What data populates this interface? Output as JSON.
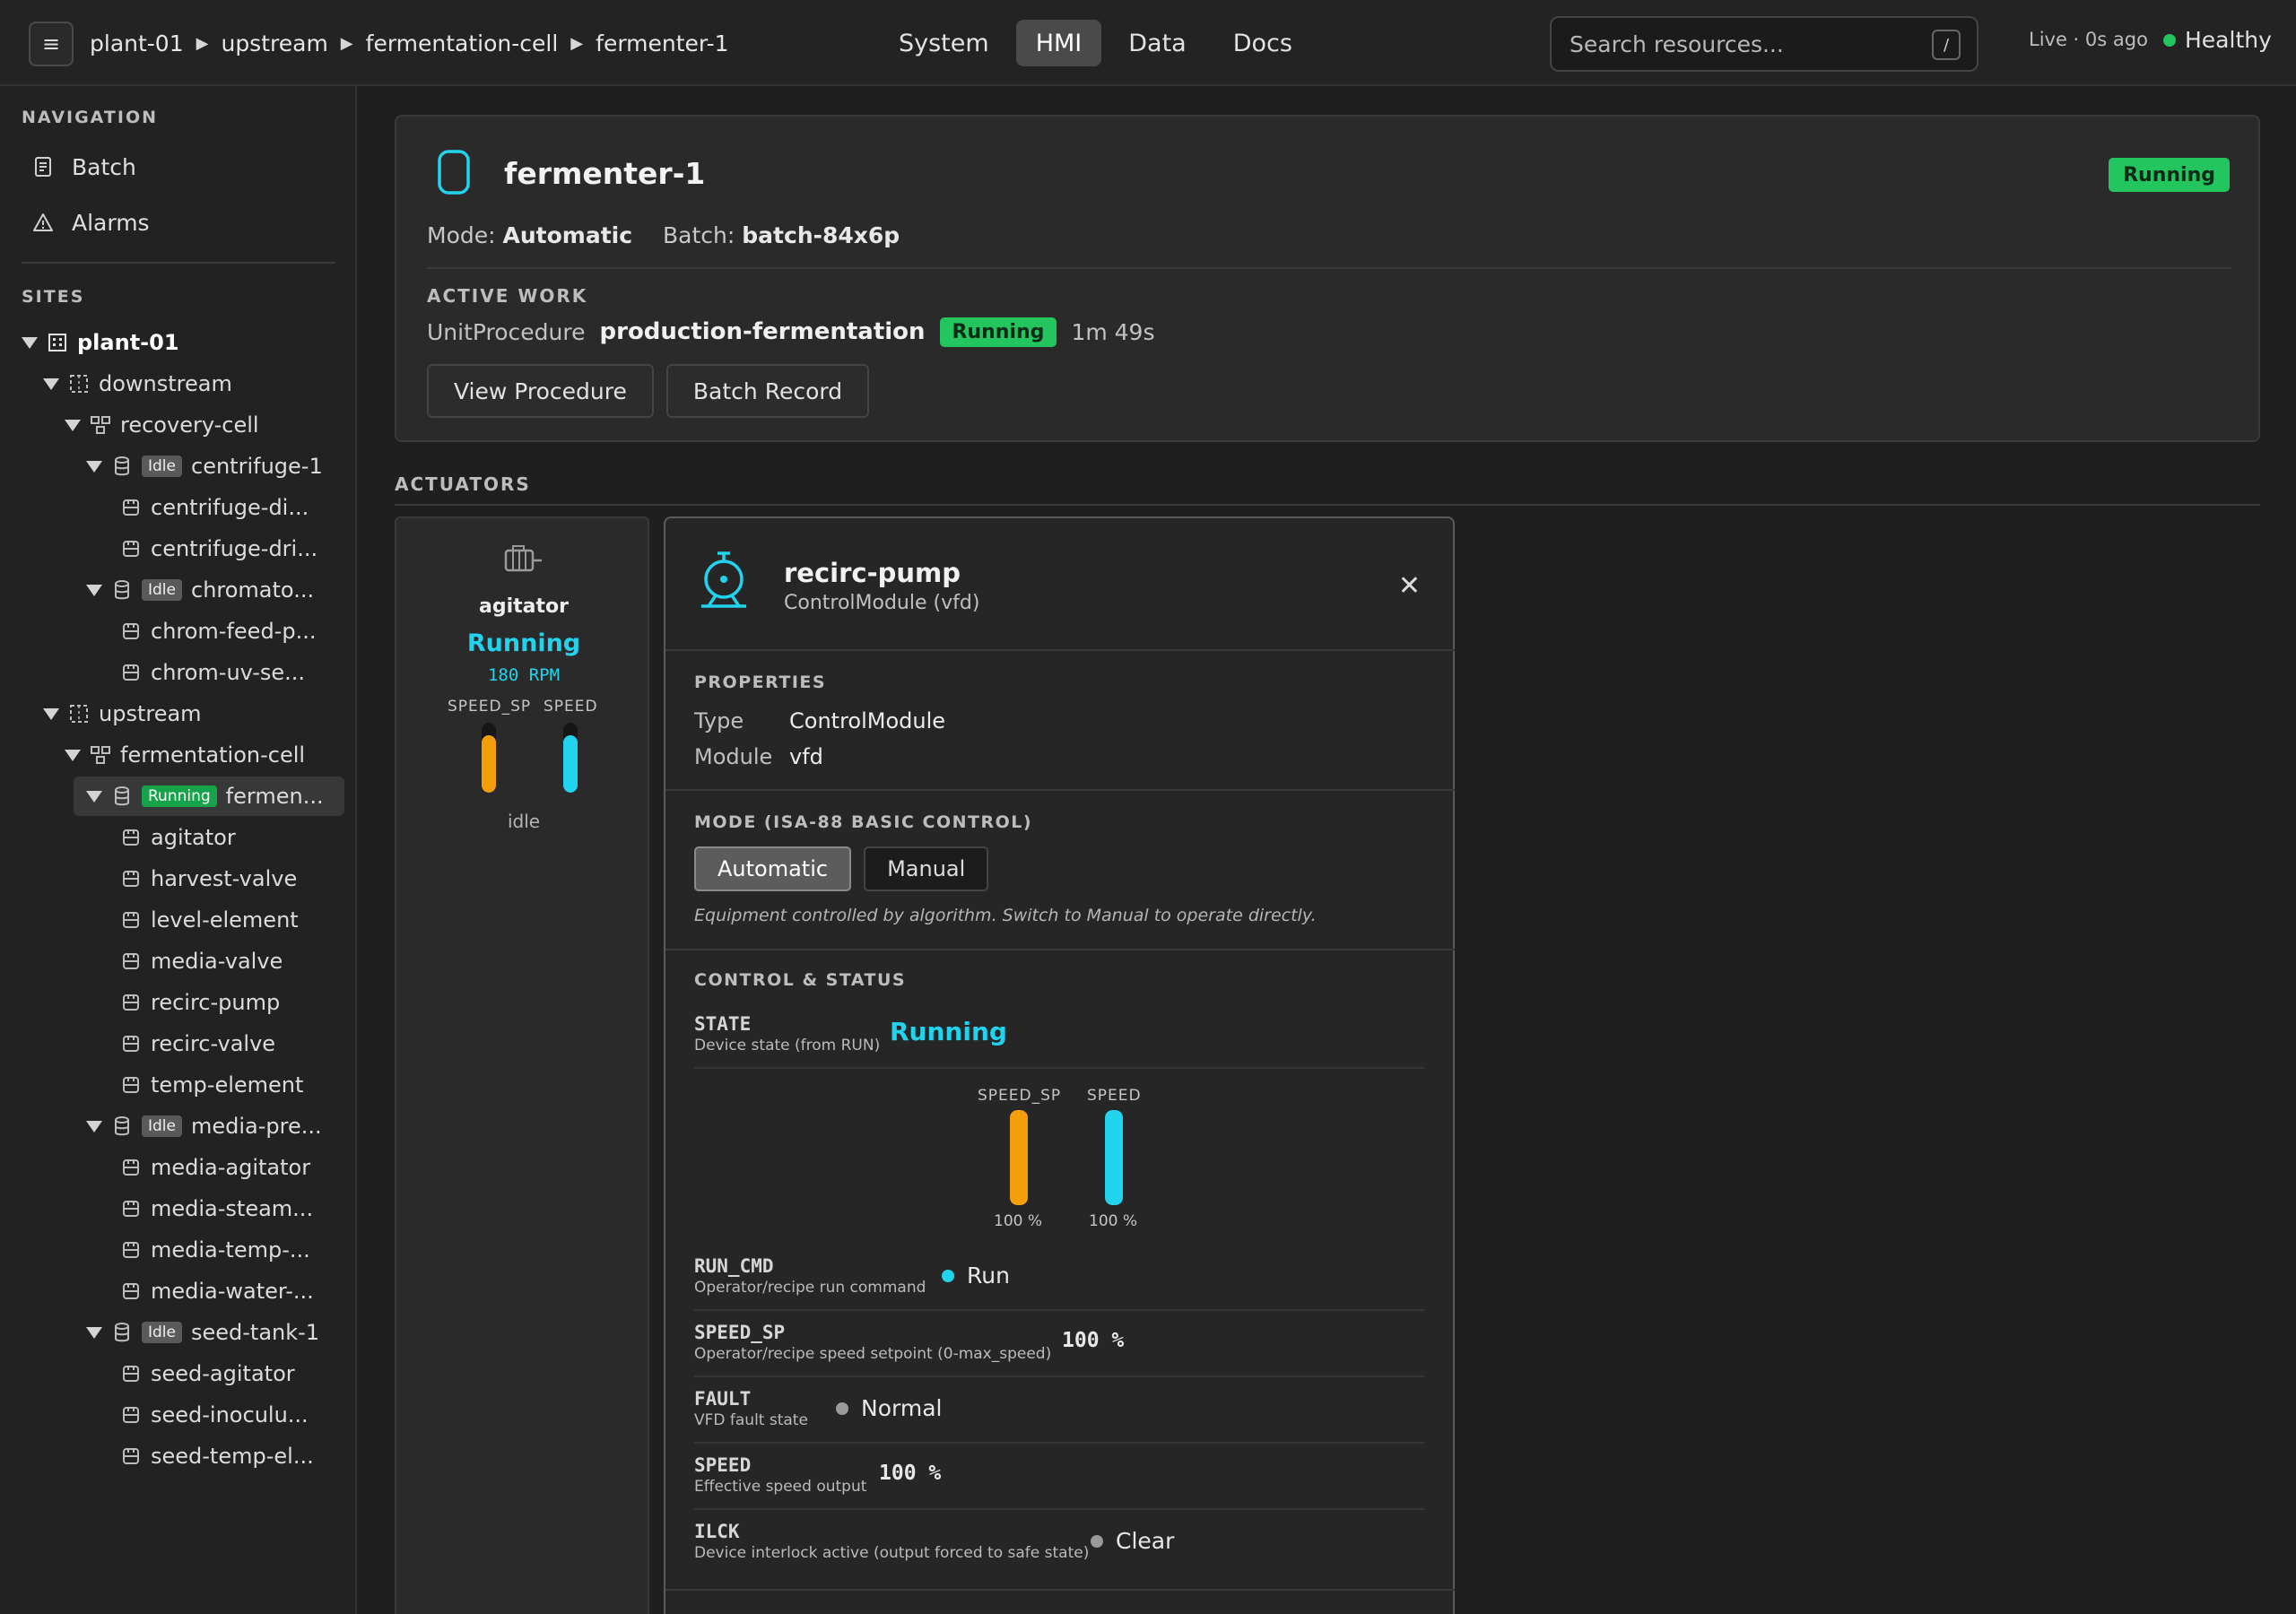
{
  "topbar": {
    "menu_icon": "hamburger-icon",
    "breadcrumb": [
      "plant-01",
      "upstream",
      "fermentation-cell",
      "fermenter-1"
    ],
    "tabs": [
      {
        "label": "System",
        "active": false
      },
      {
        "label": "HMI",
        "active": true
      },
      {
        "label": "Data",
        "active": false
      },
      {
        "label": "Docs",
        "active": false
      }
    ],
    "search_placeholder": "Search resources...",
    "search_shortcut": "/",
    "live_text": "Live · 0s ago",
    "health": "Healthy",
    "health_color": "#22c55e"
  },
  "sidebar": {
    "navigation_label": "NAVIGATION",
    "nav_items": [
      {
        "label": "Batch",
        "icon": "document-icon"
      },
      {
        "label": "Alarms",
        "icon": "warning-icon"
      }
    ],
    "sites_label": "SITES",
    "tree": [
      {
        "label": "plant-01",
        "level": 0,
        "icon": "building-icon",
        "expanded": true,
        "bold": true
      },
      {
        "label": "downstream",
        "level": 1,
        "icon": "area-icon",
        "expanded": true
      },
      {
        "label": "recovery-cell",
        "level": 2,
        "icon": "cell-icon",
        "expanded": true
      },
      {
        "label": "centrifuge-1",
        "level": 3,
        "icon": "unit-icon",
        "expanded": true,
        "badge": "Idle"
      },
      {
        "label": "centrifuge-di...",
        "level": 4,
        "icon": "module-icon"
      },
      {
        "label": "centrifuge-dri...",
        "level": 4,
        "icon": "module-icon"
      },
      {
        "label": "chromato...",
        "level": 3,
        "icon": "unit-icon",
        "expanded": true,
        "badge": "Idle"
      },
      {
        "label": "chrom-feed-p...",
        "level": 4,
        "icon": "module-icon"
      },
      {
        "label": "chrom-uv-se...",
        "level": 4,
        "icon": "module-icon"
      },
      {
        "label": "upstream",
        "level": 1,
        "icon": "area-icon",
        "expanded": true
      },
      {
        "label": "fermentation-cell",
        "level": 2,
        "icon": "cell-icon",
        "expanded": true
      },
      {
        "label": "fermen...",
        "level": 3,
        "icon": "unit-icon",
        "expanded": true,
        "badge": "Running",
        "selected": true
      },
      {
        "label": "agitator",
        "level": 4,
        "icon": "module-icon"
      },
      {
        "label": "harvest-valve",
        "level": 4,
        "icon": "module-icon"
      },
      {
        "label": "level-element",
        "level": 4,
        "icon": "module-icon"
      },
      {
        "label": "media-valve",
        "level": 4,
        "icon": "module-icon"
      },
      {
        "label": "recirc-pump",
        "level": 4,
        "icon": "module-icon"
      },
      {
        "label": "recirc-valve",
        "level": 4,
        "icon": "module-icon"
      },
      {
        "label": "temp-element",
        "level": 4,
        "icon": "module-icon"
      },
      {
        "label": "media-pre...",
        "level": 3,
        "icon": "unit-icon",
        "expanded": true,
        "badge": "Idle"
      },
      {
        "label": "media-agitator",
        "level": 4,
        "icon": "module-icon"
      },
      {
        "label": "media-steam...",
        "level": 4,
        "icon": "module-icon"
      },
      {
        "label": "media-temp-...",
        "level": 4,
        "icon": "module-icon"
      },
      {
        "label": "media-water-...",
        "level": 4,
        "icon": "module-icon"
      },
      {
        "label": "seed-tank-1",
        "level": 3,
        "icon": "unit-icon",
        "expanded": true,
        "badge": "Idle"
      },
      {
        "label": "seed-agitator",
        "level": 4,
        "icon": "module-icon"
      },
      {
        "label": "seed-inoculu...",
        "level": 4,
        "icon": "module-icon"
      },
      {
        "label": "seed-temp-el...",
        "level": 4,
        "icon": "module-icon"
      }
    ]
  },
  "unit": {
    "name": "fermenter-1",
    "icon": "vessel-icon",
    "status": "Running",
    "mode_label": "Mode:",
    "mode_value": "Automatic",
    "batch_label": "Batch:",
    "batch_value": "batch-84x6p",
    "active_work_label": "ACTIVE WORK",
    "work_type": "UnitProcedure",
    "work_name": "production-fermentation",
    "work_status": "Running",
    "work_elapsed": "1m 49s",
    "buttons": [
      "View Procedure",
      "Batch Record"
    ]
  },
  "actuators": {
    "label": "ACTUATORS",
    "agitator": {
      "icon": "motor-icon",
      "name": "agitator",
      "state": "Running",
      "value": "180 RPM",
      "bar1_label": "SPEED_SP",
      "bar2_label": "SPEED",
      "bar1_fill": 0.82,
      "bar2_fill": 0.82,
      "footer": "idle"
    }
  },
  "panel": {
    "icon": "pump-icon",
    "title": "recirc-pump",
    "subtitle": "ControlModule (vfd)",
    "close_icon": "close-icon",
    "properties_label": "PROPERTIES",
    "type_key": "Type",
    "type_value": "ControlModule",
    "module_key": "Module",
    "module_value": "vfd",
    "mode_label": "MODE (ISA-88 BASIC CONTROL)",
    "mode_options": [
      "Automatic",
      "Manual"
    ],
    "mode_hint": "Equipment controlled by algorithm. Switch to Manual to operate directly.",
    "control_label": "CONTROL & STATUS",
    "state_name": "STATE",
    "state_desc": "Device state (from RUN)",
    "state_value": "Running",
    "bars": [
      {
        "label": "SPEED_SP",
        "pct_label": "100 %",
        "fill": 1.0,
        "color": "#f59e0b"
      },
      {
        "label": "SPEED",
        "pct_label": "100 %",
        "fill": 1.0,
        "color": "#22d3ee"
      }
    ],
    "signals": [
      {
        "name": "RUN_CMD",
        "desc": "Operator/recipe run command",
        "value": "Run",
        "dot": "cyan"
      },
      {
        "name": "SPEED_SP",
        "desc": "Operator/recipe speed setpoint (0-max_speed)",
        "value": "100 %"
      },
      {
        "name": "FAULT",
        "desc": "VFD fault state",
        "value": "Normal",
        "dot": "gray"
      },
      {
        "name": "SPEED",
        "desc": "Effective speed output",
        "value": "100 %"
      },
      {
        "name": "ILCK",
        "desc": "Device interlock active (output forced to safe state)",
        "value": "Clear",
        "dot": "gray"
      }
    ]
  }
}
